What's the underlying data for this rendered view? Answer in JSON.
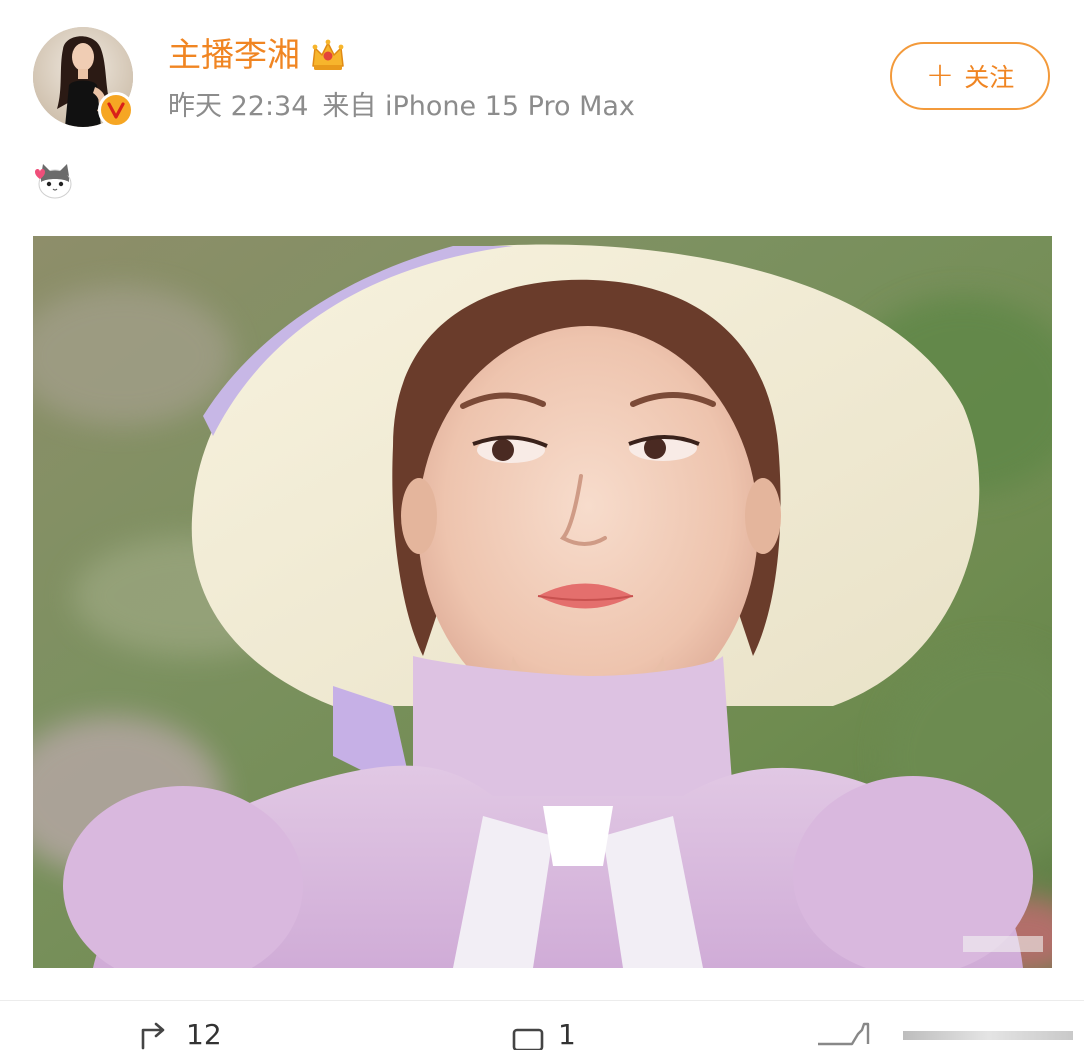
{
  "post": {
    "author": {
      "name": "主播李湘",
      "avatar_icon": "user-avatar",
      "verified_icon": "verified-badge-icon",
      "crown_icon": "crown-icon"
    },
    "time": "昨天 22:34",
    "source": "来自 iPhone 15 Pro Max",
    "follow_button": {
      "plus": "+",
      "label": "关注"
    },
    "text_emoji": "cat-heart-emoji",
    "image": {
      "subject": "photo"
    }
  },
  "actions": {
    "repost": {
      "icon": "repost-icon",
      "count": "12"
    },
    "comment": {
      "icon": "comment-icon",
      "count": "1"
    },
    "like": {
      "icon": "like-icon",
      "count": ""
    }
  },
  "colors": {
    "brand_orange": "#f08522",
    "meta_gray": "#8c8c8c",
    "border_orange": "#f39a3b"
  }
}
